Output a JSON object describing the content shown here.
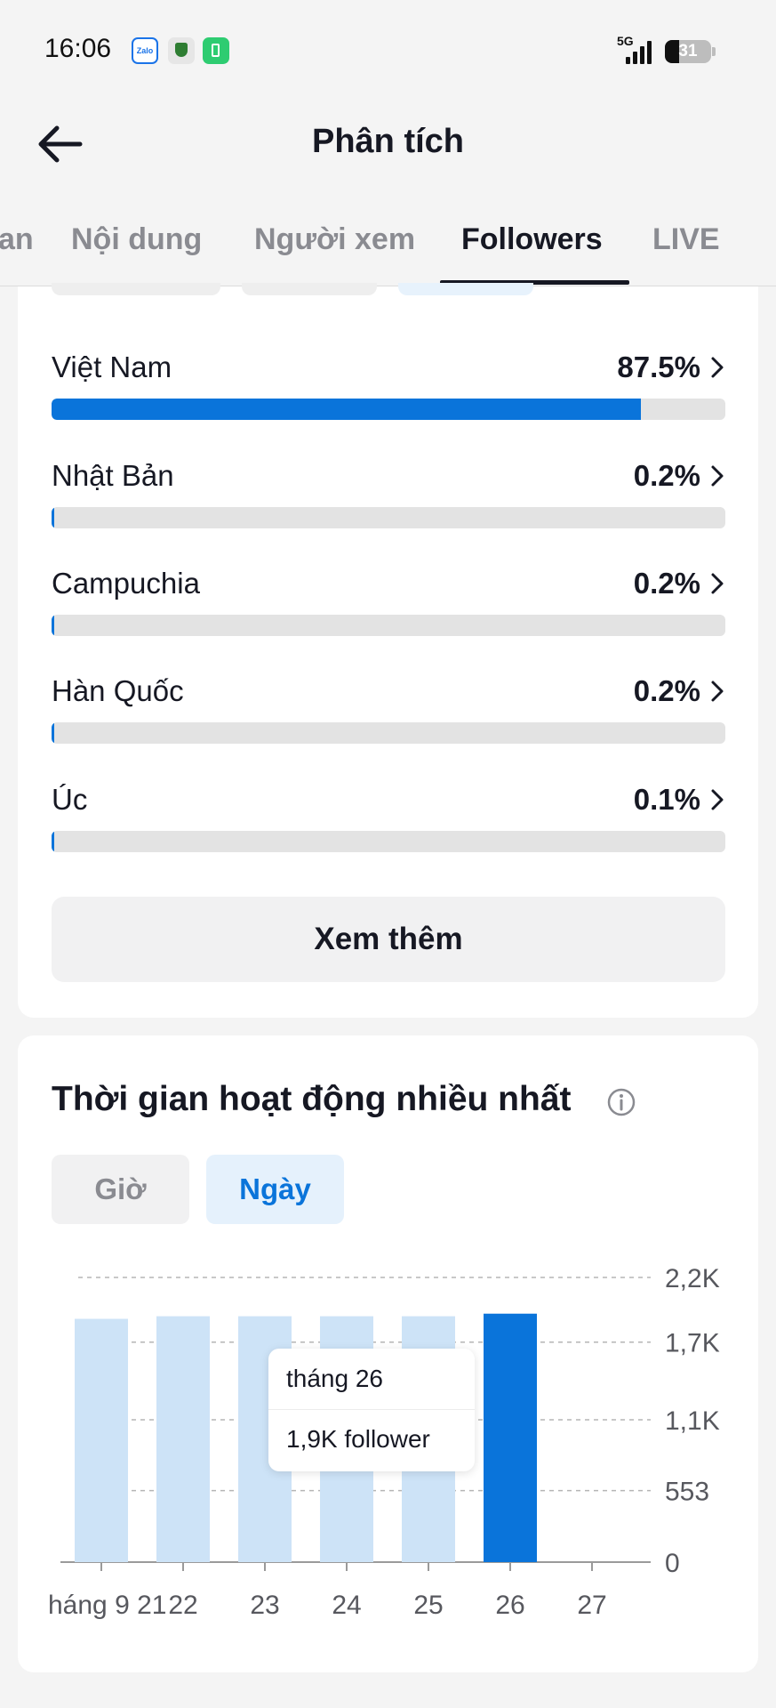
{
  "status_bar": {
    "time": "16:06",
    "zalo_label": "Zalo",
    "network": "5G",
    "battery": "31",
    "battery_level": 0.31
  },
  "header": {
    "title": "Phân tích"
  },
  "tabs": [
    {
      "label": "an"
    },
    {
      "label": "Nội dung"
    },
    {
      "label": "Người xem"
    },
    {
      "label": "Followers",
      "active": true
    },
    {
      "label": "LIVE"
    }
  ],
  "countries": {
    "items": [
      {
        "name": "Việt Nam",
        "percent_label": "87.5%",
        "percent": 87.5
      },
      {
        "name": "Nhật Bản",
        "percent_label": "0.2%",
        "percent": 0.2
      },
      {
        "name": "Campuchia",
        "percent_label": "0.2%",
        "percent": 0.2
      },
      {
        "name": "Hàn Quốc",
        "percent_label": "0.2%",
        "percent": 0.2
      },
      {
        "name": "Úc",
        "percent_label": "0.1%",
        "percent": 0.1
      }
    ],
    "more_label": "Xem thêm"
  },
  "activity": {
    "title": "Thời gian hoạt động nhiều nhất",
    "segments": {
      "hour": "Giờ",
      "day": "Ngày"
    },
    "tooltip": {
      "date": "tháng 26",
      "value": "1,9K follower"
    }
  },
  "colors": {
    "accent": "#0a74da",
    "bar_light": "#cde3f7",
    "track": "#e3e3e3"
  },
  "chart_data": {
    "type": "bar",
    "categories": [
      "háng 9 21",
      "22",
      "23",
      "24",
      "25",
      "26",
      "27"
    ],
    "values": [
      1880,
      1900,
      1900,
      1900,
      1900,
      1920,
      null
    ],
    "highlight_index": 5,
    "y_ticks": [
      0,
      553,
      1100,
      1700,
      2200
    ],
    "y_tick_labels": [
      "0",
      "553",
      "1,1K",
      "1,7K",
      "2,2K"
    ],
    "ylim": [
      0,
      2200
    ],
    "grid": true,
    "y_axis_position": "right"
  }
}
